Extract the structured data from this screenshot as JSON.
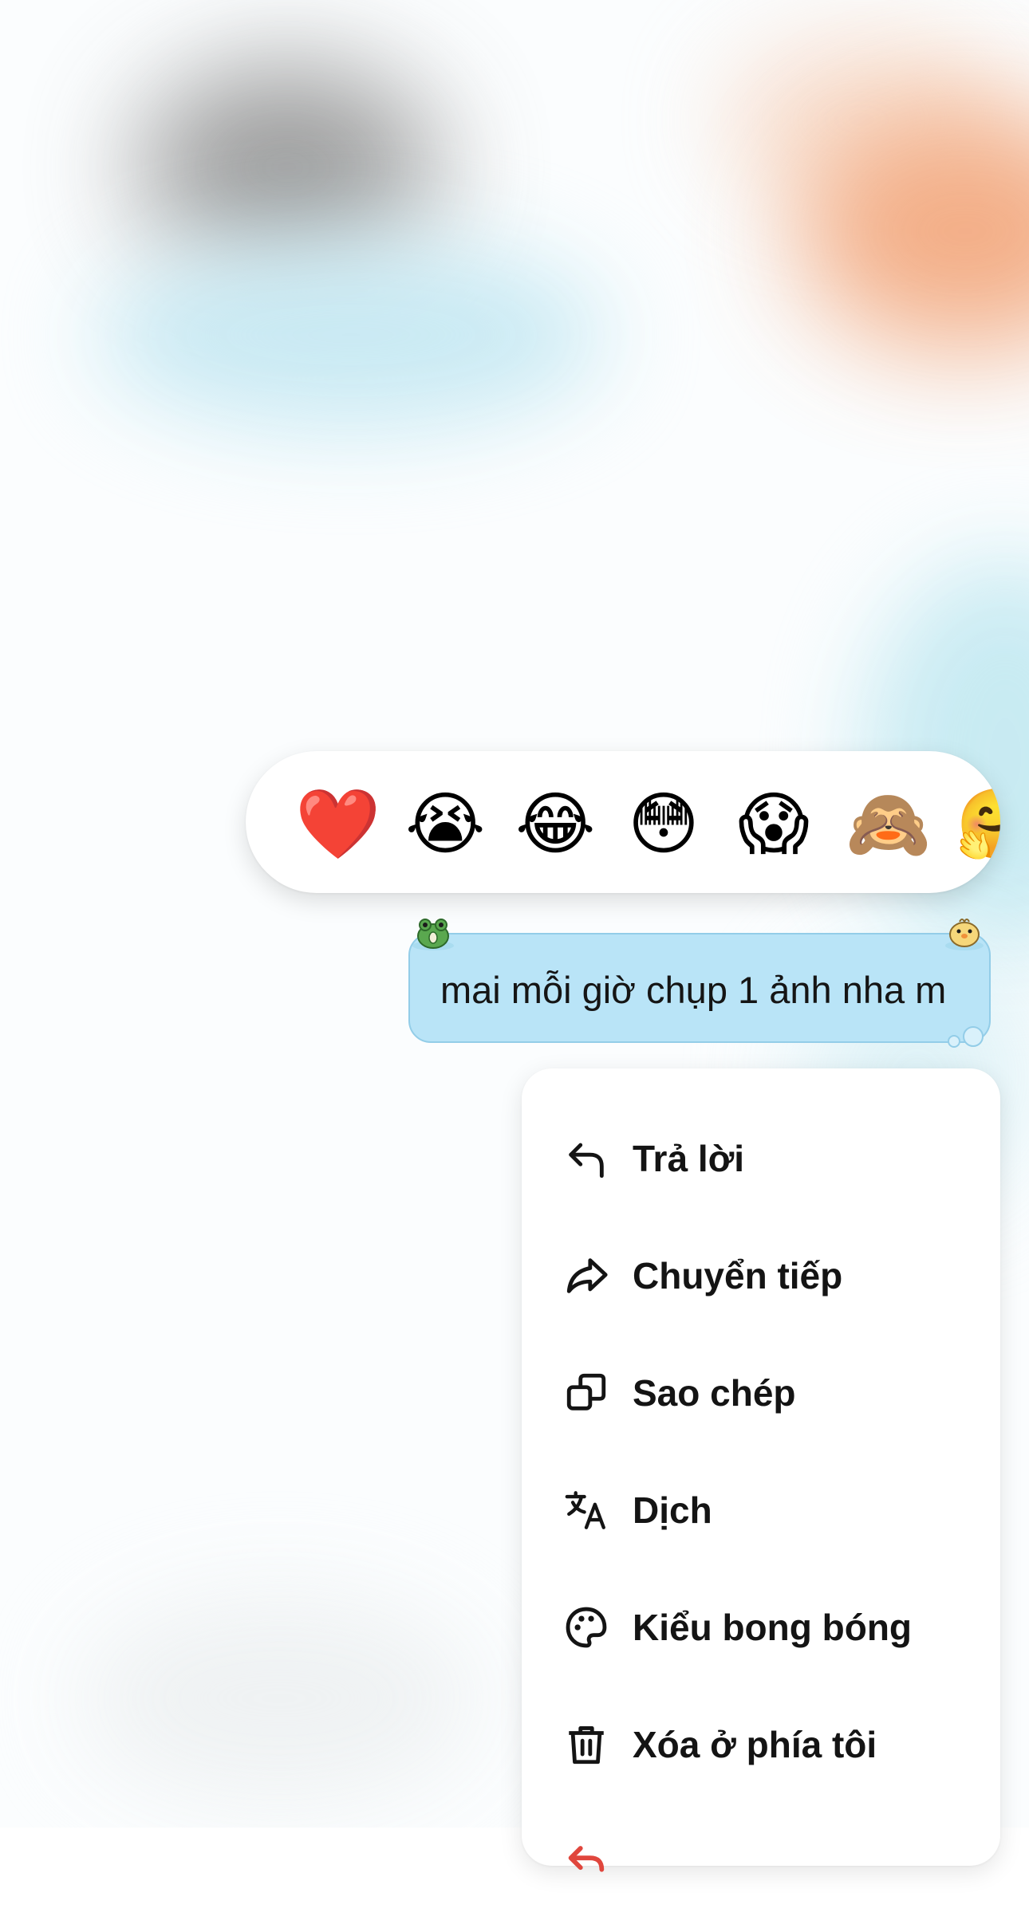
{
  "reactions": [
    {
      "emoji": "❤️",
      "name": "heart"
    },
    {
      "emoji": "😭",
      "name": "loudly-crying"
    },
    {
      "emoji": "😂",
      "name": "tears-of-joy"
    },
    {
      "emoji": "😳",
      "name": "flushed"
    },
    {
      "emoji": "😱",
      "name": "screaming"
    },
    {
      "emoji": "🙈",
      "name": "see-no-evil-monkey"
    },
    {
      "emoji": "🤗",
      "name": "hugging"
    }
  ],
  "message": {
    "text": "mai mỗi giờ chụp 1 ảnh nha m",
    "bubble_color": "#b9e4f7"
  },
  "menu": {
    "items": [
      {
        "label": "Trả lời",
        "icon": "reply-icon"
      },
      {
        "label": "Chuyển tiếp",
        "icon": "forward-icon"
      },
      {
        "label": "Sao chép",
        "icon": "copy-icon"
      },
      {
        "label": "Dịch",
        "icon": "translate-icon"
      },
      {
        "label": "Kiểu bong bóng",
        "icon": "palette-icon"
      },
      {
        "label": "Xóa ở phía tôi",
        "icon": "trash-icon"
      },
      {
        "label": "",
        "icon": "recall-icon"
      }
    ],
    "danger_color": "#e0463d"
  }
}
